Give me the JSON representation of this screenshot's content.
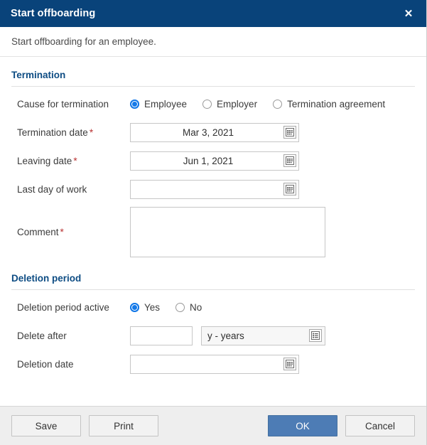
{
  "dialog": {
    "title": "Start offboarding",
    "close_icon": "close-icon",
    "subtitle": "Start offboarding for an employee."
  },
  "sections": {
    "termination": {
      "heading": "Termination",
      "cause": {
        "label": "Cause for termination",
        "options": [
          {
            "label": "Employee",
            "selected": true
          },
          {
            "label": "Employer",
            "selected": false
          },
          {
            "label": "Termination agreement",
            "selected": false
          }
        ]
      },
      "termination_date": {
        "label": "Termination date",
        "required": "*",
        "value": "Mar 3, 2021",
        "placeholder": "",
        "icon": "calendar-icon"
      },
      "leaving_date": {
        "label": "Leaving date",
        "required": "*",
        "value": "Jun 1, 2021",
        "placeholder": "",
        "icon": "calendar-icon"
      },
      "last_day_of_work": {
        "label": "Last day of work",
        "required": "",
        "value": "",
        "placeholder": "",
        "icon": "calendar-icon"
      },
      "comment": {
        "label": "Comment",
        "required": "*",
        "value": "",
        "placeholder": ""
      }
    },
    "deletion": {
      "heading": "Deletion period",
      "active": {
        "label": "Deletion period active",
        "options": [
          {
            "label": "Yes",
            "selected": true
          },
          {
            "label": "No",
            "selected": false
          }
        ]
      },
      "delete_after": {
        "label": "Delete after",
        "value": "",
        "placeholder": "",
        "unit_value": "y - years",
        "unit_icon": "list-icon"
      },
      "deletion_date": {
        "label": "Deletion date",
        "value": "",
        "placeholder": "",
        "icon": "calendar-icon"
      }
    }
  },
  "footer": {
    "save_label": "Save",
    "print_label": "Print",
    "ok_label": "OK",
    "cancel_label": "Cancel"
  },
  "colors": {
    "titlebar": "#09437a",
    "section_heading": "#0d4c83",
    "accent_radio": "#1479e8",
    "primary_button": "#4d7cb5",
    "required_star": "#b93232",
    "footer_bg": "#eeeeee"
  }
}
